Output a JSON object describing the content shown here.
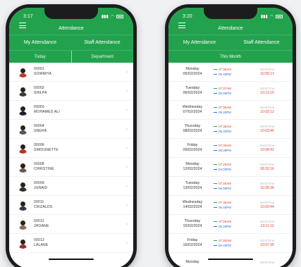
{
  "left_phone": {
    "status_time": "3:17",
    "header_title": "Attendance",
    "tabs": [
      "My Attendance",
      "Staff Attendance"
    ],
    "subtabs": [
      "Today",
      "Department"
    ],
    "staff": [
      {
        "id": "00001",
        "name": "SOWMIYA"
      },
      {
        "id": "00002",
        "name": "SHILPA"
      },
      {
        "id": "00003",
        "name": "MOHAMED ALI"
      },
      {
        "id": "00004",
        "name": "SNEHA"
      },
      {
        "id": "00006",
        "name": "SIMOUNETTE"
      },
      {
        "id": "00008",
        "name": "CHRISTINE"
      },
      {
        "id": "00009",
        "name": "JUNAID"
      },
      {
        "id": "00011",
        "name": "CRIZALDS"
      },
      {
        "id": "00012",
        "name": "JHOANE"
      },
      {
        "id": "00013",
        "name": "LALANE"
      }
    ]
  },
  "right_phone": {
    "status_time": "3:20",
    "header_title": "Attendance",
    "tabs": [
      "My Attendance",
      "Staff Attendance"
    ],
    "month_label": "This Month",
    "work_label": "WorkTime",
    "days": [
      {
        "day": "Monday",
        "date": "05/02/2024",
        "in": "07:35AM",
        "out": "05:40PM",
        "work": "10:05:13"
      },
      {
        "day": "Tuesday",
        "date": "06/02/2024",
        "in": "07:37AM",
        "out": "05:49PM",
        "work": "10:13:16"
      },
      {
        "day": "Wednesday",
        "date": "07/02/2024",
        "in": "07:35AM",
        "out": "05:40PM",
        "work": "10:03:12"
      },
      {
        "day": "Thursday",
        "date": "08/02/2024",
        "in": "07:35AM",
        "out": "05:40PM",
        "work": "10:03:46"
      },
      {
        "day": "Friday",
        "date": "09/02/2024",
        "in": "07:30AM",
        "out": "05:39PM",
        "work": "10:08:42"
      },
      {
        "day": "Monday",
        "date": "12/02/2024",
        "in": "07:29AM",
        "out": "04:00PM",
        "work": "08:32:16"
      },
      {
        "day": "Tuesday",
        "date": "13/02/2024",
        "in": "07:25AM",
        "out": "05:09PM",
        "work": "10:35:36"
      },
      {
        "day": "Wednesday",
        "date": "14/02/2024",
        "in": "07:36AM",
        "out": "05:40PM",
        "work": "10:03:44"
      },
      {
        "day": "Thursday",
        "date": "15/02/2024",
        "in": "07:28AM",
        "out": "05:40PM",
        "work": "13:11:12"
      },
      {
        "day": "Friday",
        "date": "16/02/2024",
        "in": "07:33AM",
        "out": "05:40PM",
        "work": "10:07:35"
      },
      {
        "day": "Monday",
        "date": "",
        "in": "",
        "out": "",
        "work": ""
      }
    ]
  },
  "colors": {
    "primary": "#23a24d",
    "in_time": "#e23d2d",
    "out_time": "#2e6fd1"
  }
}
